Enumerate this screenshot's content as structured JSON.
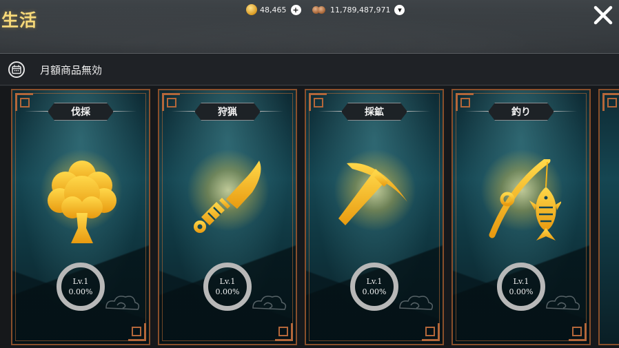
{
  "header": {
    "title": "生活",
    "gold": "48,465",
    "silver": "11,789,487,971"
  },
  "notice": {
    "text": "月額商品無効",
    "icon": "calendar-icon"
  },
  "skills": [
    {
      "label": "伐採",
      "icon": "tree-icon",
      "level": "Lv.1",
      "progress": "0.00%"
    },
    {
      "label": "狩猟",
      "icon": "knife-icon",
      "level": "Lv.1",
      "progress": "0.00%"
    },
    {
      "label": "採鉱",
      "icon": "pickaxe-icon",
      "level": "Lv.1",
      "progress": "0.00%"
    },
    {
      "label": "釣り",
      "icon": "fishing-rod-icon",
      "level": "Lv.1",
      "progress": "0.00%"
    }
  ],
  "colors": {
    "accent_gold": "#f6d979",
    "frame": "#8a4f2b",
    "icon_gold": "#f4b51c"
  }
}
